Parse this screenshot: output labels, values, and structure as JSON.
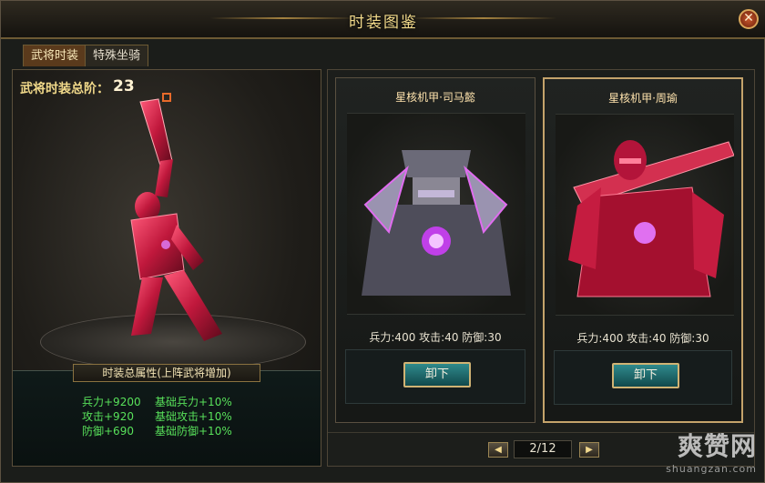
{
  "window": {
    "title": "时装图鉴"
  },
  "tabs": [
    {
      "label": "武将时装",
      "active": true
    },
    {
      "label": "特殊坐骑",
      "active": false
    }
  ],
  "left_panel": {
    "rank_label": "武将时装总阶：",
    "rank_value": "23",
    "attributes_title": "时装总属性(上阵武将增加)",
    "attributes": [
      {
        "left": "兵力+9200",
        "right": "基础兵力+10%"
      },
      {
        "left": "攻击+920",
        "right": "基础攻击+10%"
      },
      {
        "left": "防御+690",
        "right": "基础防御+10%"
      }
    ],
    "attr_color": "#58e05a"
  },
  "cards": [
    {
      "name": "星核机甲·司马懿",
      "stats": "兵力:400 攻击:40 防御:30",
      "button_label": "卸下",
      "selected": false,
      "theme": "purple-mech"
    },
    {
      "name": "星核机甲·周瑜",
      "stats": "兵力:400 攻击:40 防御:30",
      "button_label": "卸下",
      "selected": true,
      "theme": "red-mech"
    }
  ],
  "pager": {
    "page_text": "2/12",
    "prev_icon": "triangle-left-icon",
    "next_icon": "triangle-right-icon"
  },
  "watermark": {
    "main": "爽赞网",
    "sub": "shuangzan.com"
  }
}
